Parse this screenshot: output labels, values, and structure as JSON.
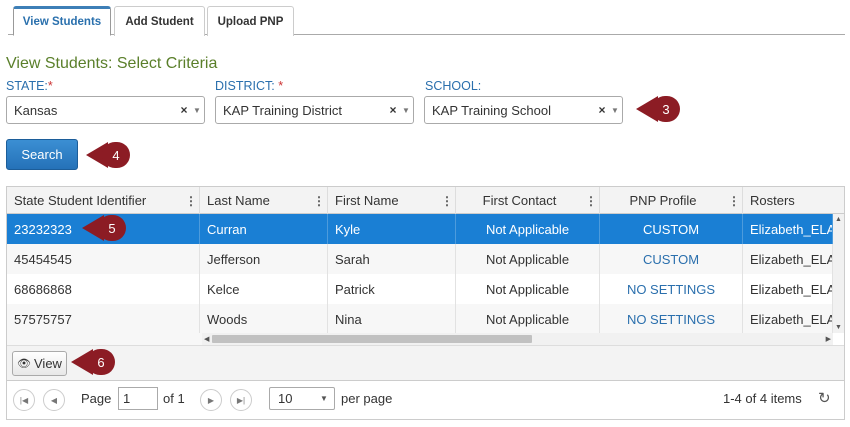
{
  "tabs": [
    {
      "label": "View Students"
    },
    {
      "label": "Add Student"
    },
    {
      "label": "Upload PNP"
    }
  ],
  "criteria": {
    "title": "View Students: Select Criteria",
    "state": {
      "label": "STATE:",
      "required": "*",
      "value": "Kansas"
    },
    "district": {
      "label": "DISTRICT: ",
      "required": "*",
      "value": "KAP Training District"
    },
    "school": {
      "label": "SCHOOL:",
      "value": "KAP Training School"
    }
  },
  "search_label": "Search",
  "callouts": [
    "3",
    "4",
    "5",
    "6"
  ],
  "grid": {
    "columns": [
      "State Student Identifier",
      "Last Name",
      "First Name",
      "First Contact",
      "PNP Profile",
      "Rosters"
    ],
    "rows": [
      {
        "id": "23232323",
        "last": "Curran",
        "first": "Kyle",
        "contact": "Not Applicable",
        "pnp": "CUSTOM",
        "roster": "Elizabeth_ELA"
      },
      {
        "id": "45454545",
        "last": "Jefferson",
        "first": "Sarah",
        "contact": "Not Applicable",
        "pnp": "CUSTOM",
        "roster": "Elizabeth_ELA"
      },
      {
        "id": "68686868",
        "last": "Kelce",
        "first": "Patrick",
        "contact": "Not Applicable",
        "pnp": "NO SETTINGS",
        "roster": "Elizabeth_ELA"
      },
      {
        "id": "57575757",
        "last": "Woods",
        "first": "Nina",
        "contact": "Not Applicable",
        "pnp": "NO SETTINGS",
        "roster": "Elizabeth_ELA"
      }
    ],
    "selected_row": 0
  },
  "view_label": "View",
  "pager": {
    "page_label": "Page",
    "page_value": "1",
    "of_label": "of 1",
    "page_size": "10",
    "per_page_label": "per page",
    "items_info": "1-4 of 4 items"
  },
  "icons": {
    "first": "first-page-icon",
    "prev": "prev-page-icon",
    "next": "next-page-icon",
    "last": "last-page-icon",
    "refresh": "refresh-icon",
    "eye": "eye-icon",
    "clear": "clear-icon",
    "dropdown": "chevron-down-icon"
  },
  "colors": {
    "accent": "#1a7fd4",
    "title_green": "#5a7f2a",
    "label_blue": "#2a6fad",
    "callout": "#8c1c24"
  }
}
